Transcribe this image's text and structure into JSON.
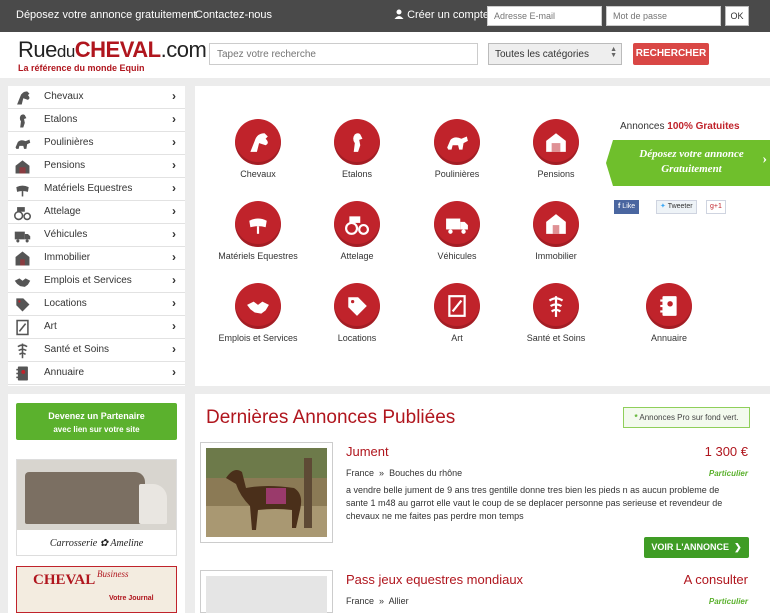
{
  "topbar": {
    "post_ad": "Déposez votre annonce gratuitement",
    "contact": "Contactez-nous",
    "create_account": "Créer un compte",
    "email_placeholder": "Adresse E-mail",
    "password_placeholder": "Mot de passe",
    "ok_label": "OK"
  },
  "header": {
    "logo_rue": "Rue",
    "logo_du": "du",
    "logo_cheval": "CHEVAL",
    "logo_com": ".com",
    "tagline": "La référence du monde Equin",
    "search_placeholder": "Tapez votre recherche",
    "category_selected": "Toutes les catégories",
    "search_button": "RECHERCHER"
  },
  "sidebar": {
    "items": [
      {
        "label": "Chevaux",
        "icon": "horse-head-icon"
      },
      {
        "label": "Etalons",
        "icon": "rearing-horse-icon"
      },
      {
        "label": "Poulinières",
        "icon": "mare-foal-icon"
      },
      {
        "label": "Pensions",
        "icon": "stable-icon"
      },
      {
        "label": "Matériels Equestres",
        "icon": "saddle-icon"
      },
      {
        "label": "Attelage",
        "icon": "carriage-icon"
      },
      {
        "label": "Véhicules",
        "icon": "truck-icon"
      },
      {
        "label": "Immobilier",
        "icon": "barn-icon"
      },
      {
        "label": "Emplois et Services",
        "icon": "handshake-icon"
      },
      {
        "label": "Locations",
        "icon": "tag-icon"
      },
      {
        "label": "Art",
        "icon": "painting-icon"
      },
      {
        "label": "Santé et Soins",
        "icon": "caduceus-icon"
      },
      {
        "label": "Annuaire",
        "icon": "address-book-icon"
      }
    ]
  },
  "categories": [
    {
      "label": "Chevaux",
      "icon": "horse-head-icon"
    },
    {
      "label": "Etalons",
      "icon": "rearing-horse-icon"
    },
    {
      "label": "Poulinières",
      "icon": "mare-foal-icon"
    },
    {
      "label": "Pensions",
      "icon": "stable-icon"
    },
    {
      "label": "Matériels Equestres",
      "icon": "saddle-icon"
    },
    {
      "label": "Attelage",
      "icon": "carriage-icon"
    },
    {
      "label": "Véhicules",
      "icon": "truck-icon"
    },
    {
      "label": "Immobilier",
      "icon": "barn-icon"
    },
    {
      "label": "Emplois et Services",
      "icon": "handshake-icon"
    },
    {
      "label": "Locations",
      "icon": "tag-icon"
    },
    {
      "label": "Art",
      "icon": "painting-icon"
    },
    {
      "label": "Santé et Soins",
      "icon": "caduceus-icon"
    },
    {
      "label": "Annuaire",
      "icon": "address-book-icon"
    }
  ],
  "promo": {
    "title_prefix": "Annonces",
    "title_highlight": "100% Gratuites",
    "ribbon_line1": "Déposez votre annonce",
    "ribbon_line2": "Gratuitement",
    "fb_like": "Like",
    "tweet": "Tweeter",
    "gplus": "g+1"
  },
  "left": {
    "partner_line1": "Devenez un Partenaire",
    "partner_line2": "avec lien sur votre site",
    "ad1_caption": "Carrosserie ✿ Ameline",
    "ad2_title": "CHEVAL",
    "ad2_sub": "Business",
    "ad2_journal": "Votre Journal"
  },
  "listings": {
    "section_title": "Dernières Annonces Publiées",
    "pro_note_prefix": "*",
    "pro_note": "Annonces Pro sur fond vert.",
    "voir_label": "VOIR L'ANNONCE",
    "items": [
      {
        "title": "Jument",
        "price": "1 300 €",
        "country": "France",
        "sep": "»",
        "region": "Bouches du rhône",
        "type": "Particulier",
        "description": "a vendre belle jument de 9 ans tres gentille donne tres bien les pieds n as aucun probleme de sante 1 m48 au garrot elle vaut le coup de se deplacer personne pas serieuse et revendeur de chevaux ne me faites pas perdre mon temps"
      },
      {
        "title": "Pass jeux equestres mondiaux",
        "price": "A consulter",
        "country": "France",
        "sep": "»",
        "region": "Allier",
        "type": "Particulier"
      }
    ]
  },
  "colors": {
    "brand_red": "#b0161e",
    "icon_red": "#c0232b",
    "green": "#5bb12d",
    "topbar": "#4a4a4a"
  }
}
